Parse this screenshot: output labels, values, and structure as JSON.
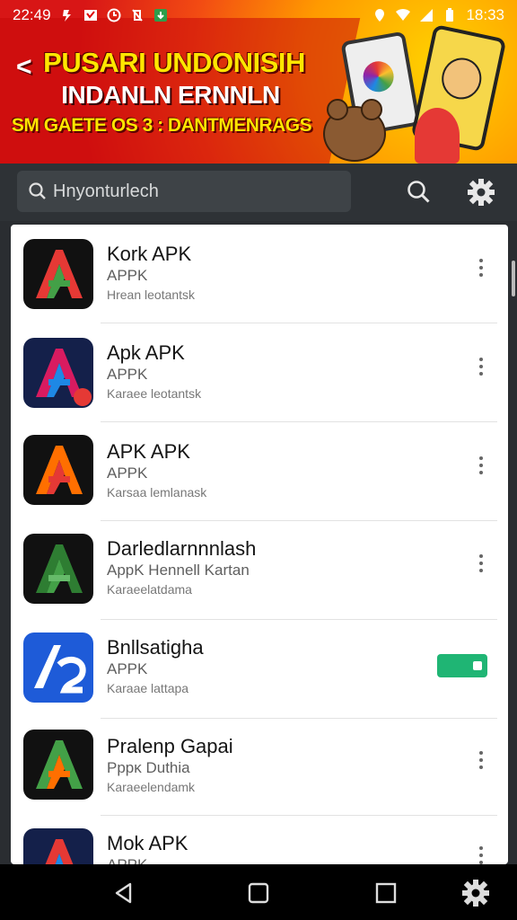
{
  "status_bar": {
    "time_left": "22:49",
    "time_right": "18:33"
  },
  "banner": {
    "line1": "PUSARI UNDONISIH",
    "line2": "INDANLN ERNNLN",
    "line3": "SM GAETE OS 3 : DANTMENRAGS"
  },
  "search": {
    "placeholder": "Hnyonturlech"
  },
  "apps": [
    {
      "title": "Kork APK",
      "subtitle": "APPK",
      "desc": "Hrean leotantsk",
      "icon_colors": [
        "#e53935",
        "#43a047"
      ],
      "action": "more"
    },
    {
      "title": "Apk APK",
      "subtitle": "APPK",
      "desc": "Karaee leotantsk",
      "icon_colors": [
        "#d81b60",
        "#1e88e5"
      ],
      "action": "more"
    },
    {
      "title": "APK APK",
      "subtitle": "APPK",
      "desc": "Karsaa lemlanask",
      "icon_colors": [
        "#ff6f00",
        "#e53935"
      ],
      "action": "more"
    },
    {
      "title": "Darledlarnnnlash",
      "subtitle": "AppK Hennell Kartan",
      "desc": "Karaeelatdama",
      "icon_colors": [
        "#2e7d32",
        "#43a047"
      ],
      "action": "more"
    },
    {
      "title": "Bnllsatigha",
      "subtitle": "APPK",
      "desc": "Karaae lattapa",
      "icon_colors": [
        "#1e5bd8",
        "#ffffff"
      ],
      "action": "toggle"
    },
    {
      "title": "Pralenp Gapai",
      "subtitle": "Pppĸ Duthia",
      "desc": "Karaeelendamk",
      "icon_colors": [
        "#43a047",
        "#ff6f00"
      ],
      "action": "more"
    },
    {
      "title": "Mok APK",
      "subtitle": "APPK",
      "desc": "",
      "icon_colors": [
        "#1e88e5",
        "#e53935"
      ],
      "action": "more"
    }
  ],
  "icons": {
    "search": "search-icon",
    "settings": "gear-icon",
    "back": "back-icon",
    "home": "home-icon",
    "recents": "recents-icon",
    "more": "more-vert-icon"
  }
}
